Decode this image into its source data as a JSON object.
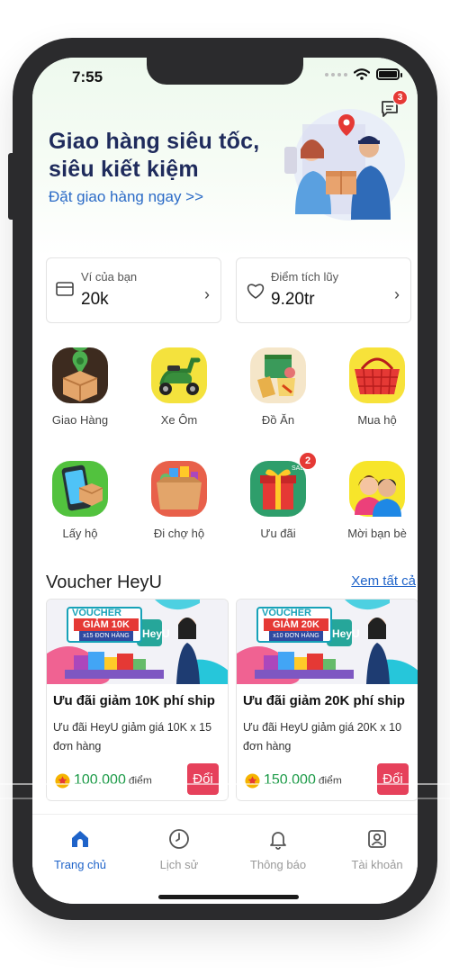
{
  "status_bar": {
    "time": "7:55"
  },
  "header": {
    "notification_count": "3"
  },
  "hero": {
    "title_line1": "Giao hàng siêu tốc,",
    "title_line2": "siêu kiết kiệm",
    "cta": "Đặt giao hàng ngay  >>"
  },
  "wallet": {
    "label": "Ví của bạn",
    "value": "20k"
  },
  "points": {
    "label": "Điểm tích lũy",
    "value": "9.20tr"
  },
  "services": [
    {
      "label": "Giao Hàng",
      "icon": "delivery-box-icon"
    },
    {
      "label": "Xe Ôm",
      "icon": "scooter-icon"
    },
    {
      "label": "Đồ Ăn",
      "icon": "food-icon"
    },
    {
      "label": "Mua hộ",
      "icon": "shopping-basket-icon"
    },
    {
      "label": "Lấy hộ",
      "icon": "pickup-phone-icon"
    },
    {
      "label": "Đi chợ hộ",
      "icon": "grocery-box-icon"
    },
    {
      "label": "Ưu đãi",
      "icon": "gift-icon",
      "badge": "2"
    },
    {
      "label": "Mời bạn bè",
      "icon": "invite-friends-icon"
    }
  ],
  "vouchers": {
    "section_title": "Voucher HeyU",
    "see_all": "Xem tất cả",
    "items": [
      {
        "banner_voucher": "VOUCHER",
        "banner_amount": "GIẢM 10K",
        "banner_orders": "x15 ĐƠN HÀNG",
        "title": "Ưu đãi giảm 10K phí ship",
        "description": "Ưu đãi HeyU giảm giá 10K x 15 đơn hàng",
        "price": "100.000",
        "unit": "điểm",
        "button": "Đổi"
      },
      {
        "banner_voucher": "VOUCHER",
        "banner_amount": "GIẢM 20K",
        "banner_orders": "x10 ĐƠN HÀNG",
        "title": "Ưu đãi giảm 20K phí ship",
        "description": "Ưu đãi HeyU giảm giá 20K x 10 đơn hàng",
        "price": "150.000",
        "unit": "điểm",
        "button": "Đổi"
      }
    ]
  },
  "tabbar": {
    "home": "Trang chủ",
    "history": "Lịch sử",
    "notifications": "Thông báo",
    "account": "Tài khoản"
  },
  "colors": {
    "accent": "#1e63c9",
    "points_green": "#1a9a46",
    "redeem_button": "#e6415b",
    "hero_text": "#1f2b5c"
  }
}
